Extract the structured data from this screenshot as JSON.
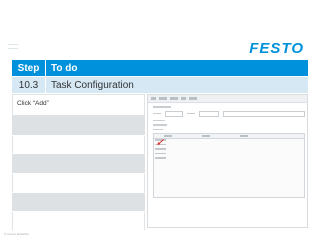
{
  "brand": {
    "logo_text": "FESTO",
    "color": "#0091dc"
  },
  "table": {
    "headers": [
      "Step",
      "To do"
    ],
    "step": "10.3",
    "task": "Task Configuration"
  },
  "instruction": "Click “Add”",
  "colors": {
    "header_bg": "#0091dc",
    "value_row_bg": "#d5e8f4",
    "grey_cell": "#dde1e4",
    "arrow": "#e0312f"
  },
  "footer": {
    "text": "© Festo Didactic"
  }
}
